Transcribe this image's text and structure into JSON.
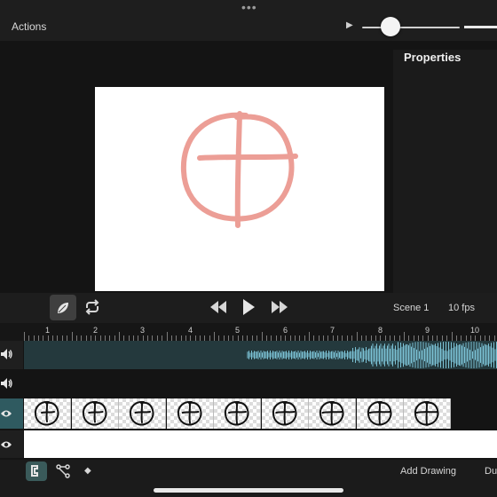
{
  "topbar": {
    "grabber": "•••",
    "actions_label": "Actions",
    "play_glyph": "▶"
  },
  "properties": {
    "label": "Properties"
  },
  "controls": {
    "scene_label": "Scene 1",
    "fps_label": "10 fps"
  },
  "ruler": {
    "numbers": [
      "1",
      "2",
      "3",
      "4",
      "5",
      "6",
      "7",
      "8",
      "9",
      "10"
    ]
  },
  "tracks": {
    "audio_icon": "speaker-icon",
    "visibility_icon": "eye-icon",
    "frame_count": 9
  },
  "bottombar": {
    "add_drawing_label": "Add Drawing",
    "du_label": "Du",
    "diamond_glyph": "◆"
  },
  "colors": {
    "accent_teal": "#2f5a60",
    "waveform": "#7cc3d6",
    "sketch_red": "#e8877c"
  }
}
